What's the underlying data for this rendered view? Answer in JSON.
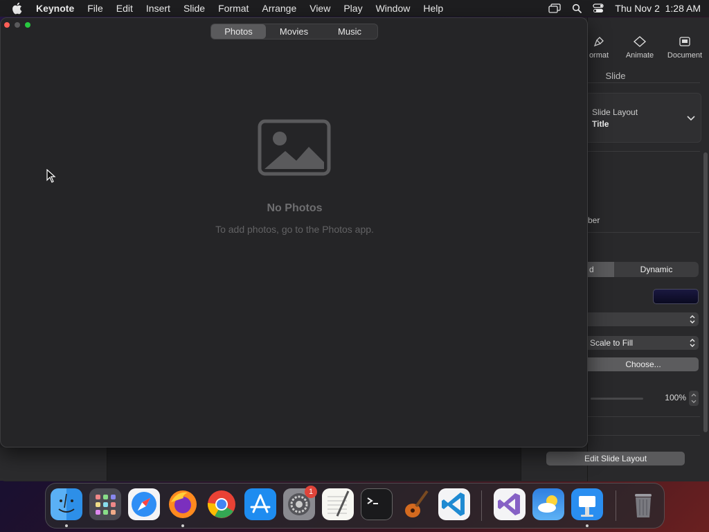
{
  "menubar": {
    "app_name": "Keynote",
    "items": [
      "File",
      "Edit",
      "Insert",
      "Slide",
      "Format",
      "Arrange",
      "View",
      "Play",
      "Window",
      "Help"
    ],
    "datetime": "Thu Nov 2  1:28 AM"
  },
  "media_browser": {
    "tabs": [
      {
        "label": "Photos",
        "active": true
      },
      {
        "label": "Movies",
        "active": false
      },
      {
        "label": "Music",
        "active": false
      }
    ],
    "empty_title": "No Photos",
    "empty_subtitle": "To add photos, go to the Photos app."
  },
  "inspector": {
    "tabs": [
      {
        "label": "ormat",
        "icon": "paintbrush-icon"
      },
      {
        "label": "Animate",
        "icon": "animate-diamond-icon"
      },
      {
        "label": "Document",
        "icon": "document-icon"
      }
    ],
    "heading": "Slide",
    "slide_layout_caption": "Slide Layout",
    "slide_layout_value": "Title",
    "partial_text_number": "ber",
    "background_segment": {
      "left": "d",
      "right": "Dynamic"
    },
    "fill_popup_value": "",
    "scale_popup_value": "Scale to Fill",
    "choose_button": "Choose...",
    "opacity_value": "100%",
    "edit_layout_button": "Edit Slide Layout"
  },
  "dock": {
    "apps": [
      "Finder",
      "Launchpad",
      "Safari",
      "Firefox",
      "Chrome",
      "App Store",
      "System Settings",
      "TextEdit",
      "Terminal",
      "GarageBand",
      "Visual Studio Code",
      "Visual Studio",
      "Weather",
      "Keynote",
      "Trash"
    ],
    "settings_badge": "1"
  },
  "colors": {
    "accent_badge": "#e0443a",
    "traffic_close": "#ff5f57",
    "traffic_min": "#5a5a5c",
    "traffic_max": "#28c840"
  }
}
